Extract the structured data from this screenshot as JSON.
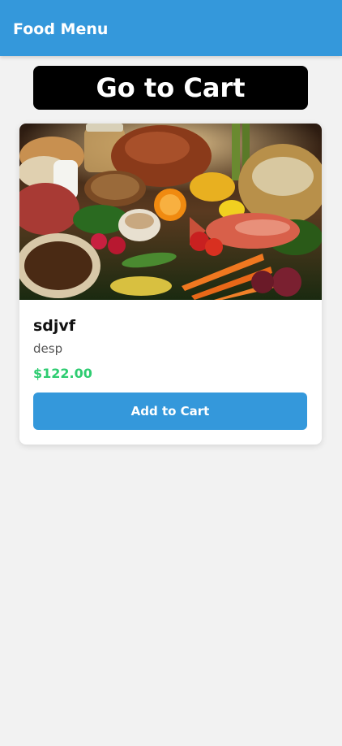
{
  "header": {
    "title": "Food Menu"
  },
  "cart_button": {
    "label": "Go to Cart"
  },
  "menu_items": [
    {
      "name": "sdjvf",
      "description": "desp",
      "price": "$122.00",
      "add_label": "Add to Cart",
      "image": "food-photo"
    }
  ],
  "colors": {
    "header_bg": "#3498db",
    "cart_button_bg": "#000000",
    "price": "#2ecc71",
    "add_button_bg": "#3498db",
    "page_bg": "#f2f2f2"
  }
}
